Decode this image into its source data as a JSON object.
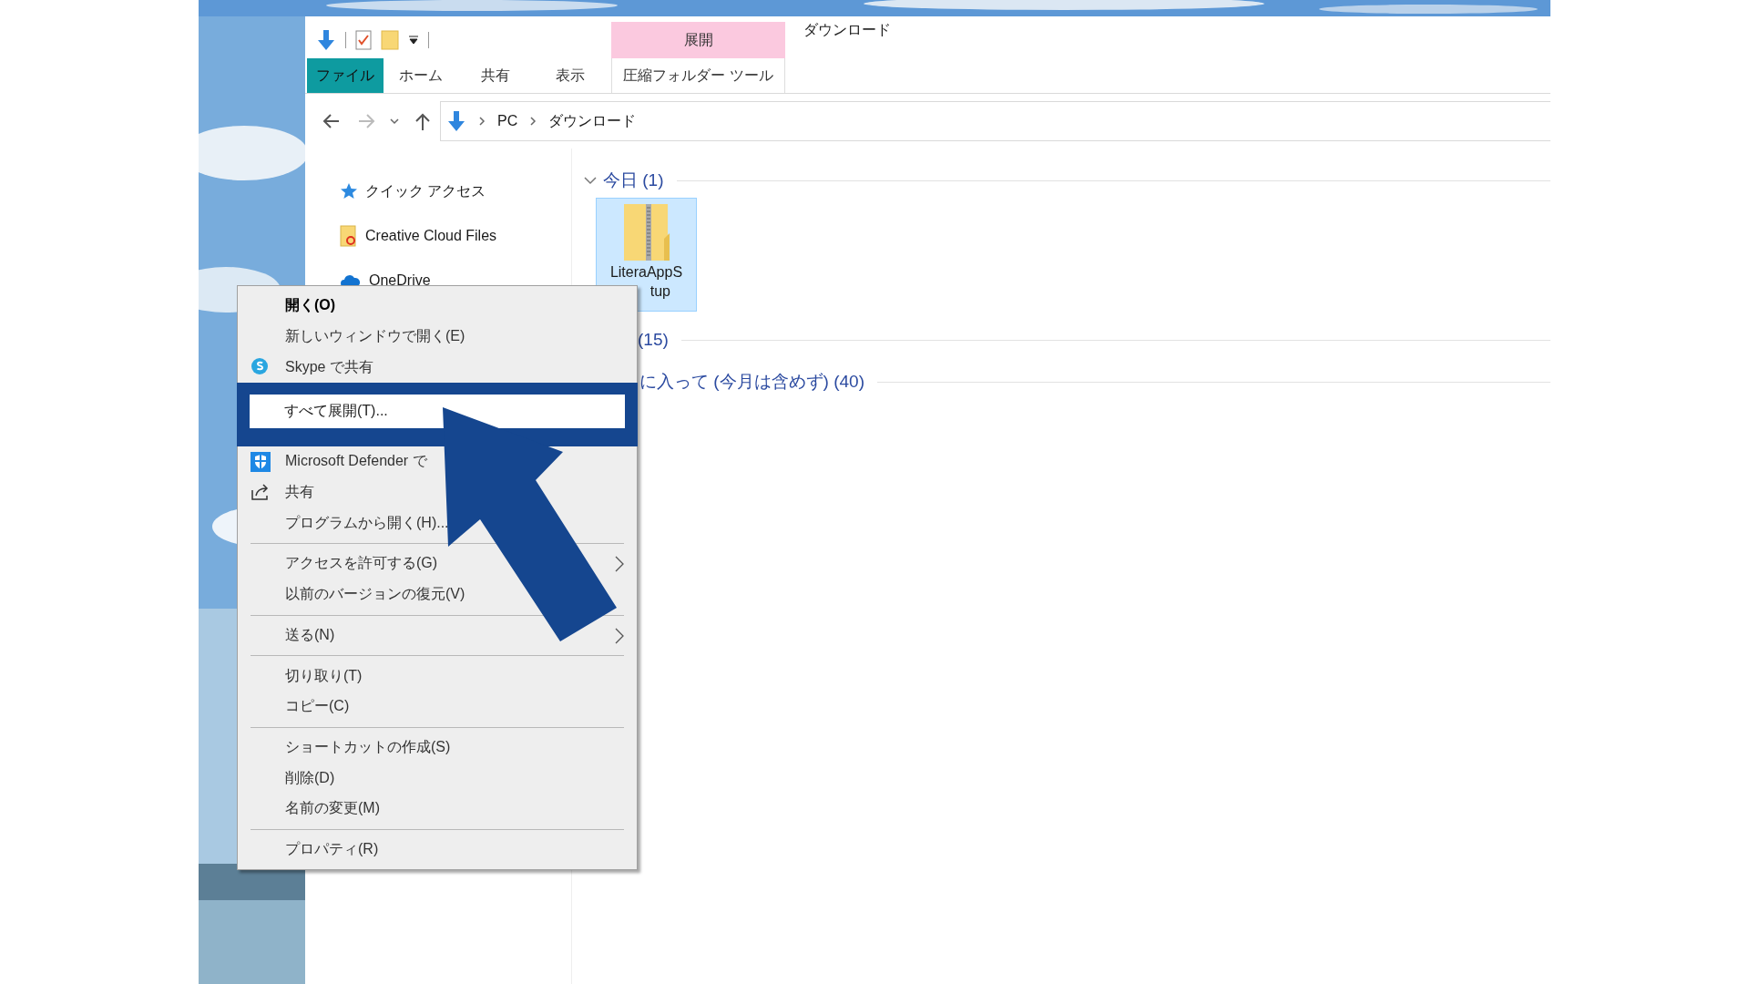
{
  "ribbon": {
    "context_header": "展開",
    "title": "ダウンロード",
    "tabs": [
      {
        "label": "ファイル",
        "kind": "file"
      },
      {
        "label": "ホーム",
        "kind": "tab"
      },
      {
        "label": "共有",
        "kind": "tab"
      },
      {
        "label": "表示",
        "kind": "tab"
      },
      {
        "label": "圧縮フォルダー ツール",
        "kind": "contextual"
      }
    ]
  },
  "address": {
    "crumbs": [
      "PC",
      "ダウンロード"
    ]
  },
  "nav": [
    {
      "label": "クイック アクセス",
      "kind": "star"
    },
    {
      "label": "Creative Cloud Files",
      "kind": "cloudfiles"
    },
    {
      "label": "OneDrive",
      "kind": "onedrive"
    }
  ],
  "groups": [
    {
      "header": "今日 (1)",
      "expanded": true,
      "files": [
        {
          "name_lines": [
            "LiteraAppS",
            "tup"
          ],
          "selected": true
        }
      ]
    },
    {
      "header": "(15)"
    },
    {
      "header": "に入って (今月は含めず) (40)"
    }
  ],
  "menu": {
    "sections": [
      [
        {
          "label": "開く(O)",
          "default": true,
          "kind": "plain"
        },
        {
          "label": "新しいウィンドウで開く(E)",
          "default": false,
          "kind": "plain"
        },
        {
          "label": "Skype で共有",
          "default": false,
          "kind": "skype"
        },
        {
          "label": "すべて展開(T)...",
          "default": false,
          "kind": "highlighted"
        },
        {
          "label": "Microsoft Defender で",
          "default": false,
          "kind": "defender"
        },
        {
          "label": "共有",
          "default": false,
          "kind": "share"
        },
        {
          "label": "プログラムから開く(H)...",
          "default": false,
          "kind": "plain"
        }
      ],
      [
        {
          "label": "アクセスを許可する(G)",
          "default": false,
          "kind": "plain",
          "submenu": true
        },
        {
          "label": "以前のバージョンの復元(V)",
          "default": false,
          "kind": "plain",
          "submenu": false
        }
      ],
      [
        {
          "label": "送る(N)",
          "default": false,
          "kind": "plain",
          "submenu": true
        }
      ],
      [
        {
          "label": "切り取り(T)",
          "default": false,
          "kind": "plain"
        },
        {
          "label": "コピー(C)",
          "default": false,
          "kind": "plain"
        }
      ],
      [
        {
          "label": "ショートカットの作成(S)",
          "default": false,
          "kind": "plain"
        },
        {
          "label": "削除(D)",
          "default": false,
          "kind": "plain"
        },
        {
          "label": "名前の変更(M)",
          "default": false,
          "kind": "plain"
        }
      ],
      [
        {
          "label": "プロパティ(R)",
          "default": false,
          "kind": "plain"
        }
      ]
    ]
  }
}
